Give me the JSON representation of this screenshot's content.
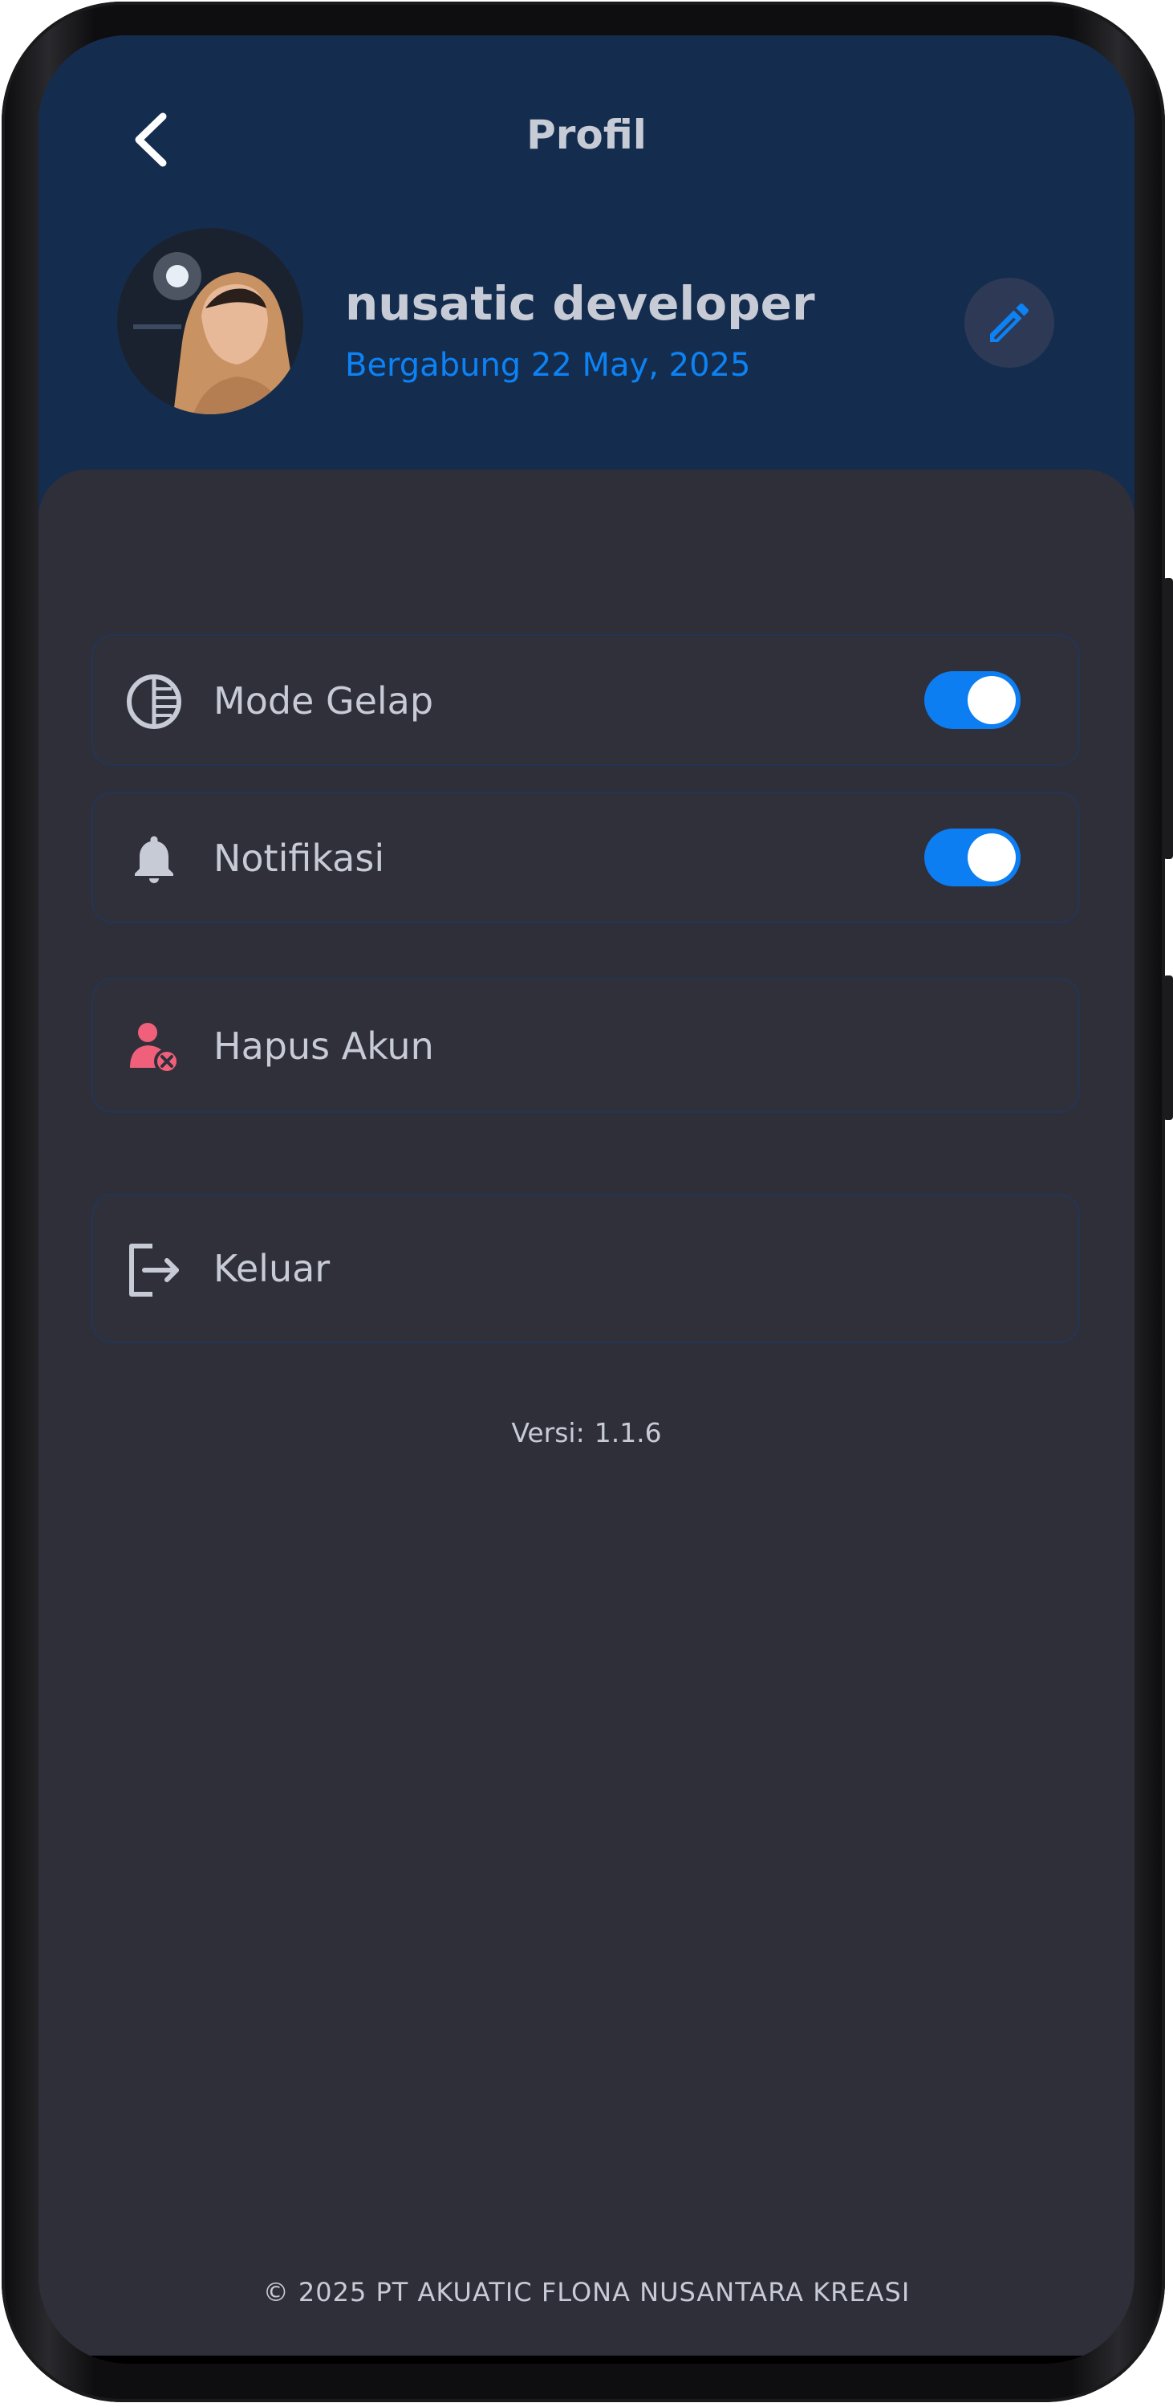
{
  "header": {
    "title": "Profil",
    "back_icon": "chevron-left-icon"
  },
  "profile": {
    "name": "nusatic developer",
    "joined": "Bergabung 22 May, 2025",
    "edit_icon": "pencil-icon"
  },
  "settings": [
    {
      "icon": "contrast-icon",
      "label": "Mode Gelap",
      "toggle": true,
      "enabled": true
    },
    {
      "icon": "bell-icon",
      "label": "Notifikasi",
      "toggle": true,
      "enabled": true
    },
    {
      "icon": "user-remove-icon",
      "label": "Hapus Akun",
      "toggle": false
    },
    {
      "icon": "logout-icon",
      "label": "Keluar",
      "toggle": false
    }
  ],
  "version": {
    "label": "Versi:",
    "value": "1.1.6"
  },
  "footer": {
    "copyright": "© 2025 PT AKUATIC FLONA NUSANTARA KREASI"
  },
  "colors": {
    "header_bg": "#142d4f",
    "sheet_bg": "#2f2f3a",
    "accent": "#0d82f5",
    "text": "#c7cbd6",
    "danger": "#f0607a"
  }
}
